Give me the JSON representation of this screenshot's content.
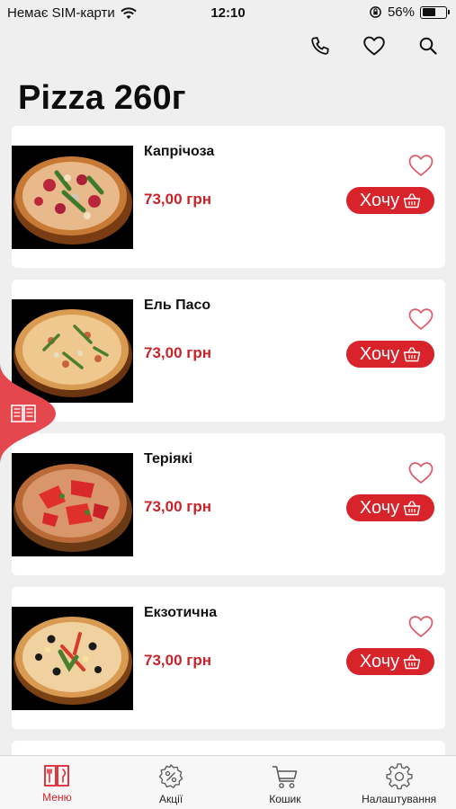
{
  "status_bar": {
    "carrier": "Немає SIM-карти",
    "time": "12:10",
    "battery": "56%",
    "battery_level": 0.56
  },
  "top_actions": [
    {
      "icon": "phone-icon"
    },
    {
      "icon": "heart-icon"
    },
    {
      "icon": "search-icon"
    }
  ],
  "page": {
    "title": "Pizza 260г"
  },
  "products": [
    {
      "name": "Капрічоза",
      "price": "73,00 грн",
      "button": "Хочу"
    },
    {
      "name": "Ель Пасо",
      "price": "73,00 грн",
      "button": "Хочу"
    },
    {
      "name": "Теріякі",
      "price": "73,00 грн",
      "button": "Хочу"
    },
    {
      "name": "Екзотична",
      "price": "73,00 грн",
      "button": "Хочу"
    }
  ],
  "tabs": [
    {
      "label": "Меню",
      "icon": "menu-book-icon",
      "active": true
    },
    {
      "label": "Акції",
      "icon": "discount-badge-icon",
      "active": false
    },
    {
      "label": "Кошик",
      "icon": "cart-icon",
      "active": false
    },
    {
      "label": "Налаштування",
      "icon": "gear-icon",
      "active": false
    }
  ],
  "colors": {
    "accent": "#d9232b",
    "price": "#c8232b",
    "background": "#efefef"
  }
}
